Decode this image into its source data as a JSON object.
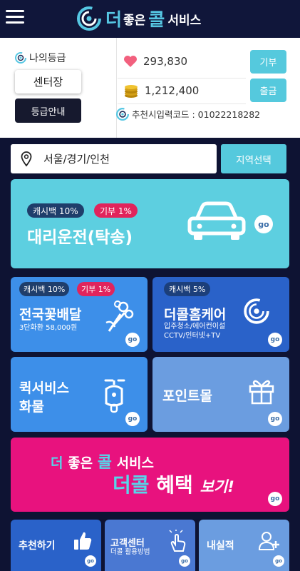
{
  "header": {
    "logo_part1": "더",
    "logo_part2": "좋은",
    "logo_part3": "콜",
    "logo_part4": "서비스"
  },
  "profile": {
    "grade_label": "나의등급",
    "grade_value": "센터장",
    "grade_button": "등급안내",
    "points": "293,830",
    "donate_button": "기부",
    "coins": "1,212,400",
    "withdraw_button": "출금",
    "referral_label": "추천시입력코드 : 01022218282"
  },
  "location": {
    "value": "서울/경기/인천",
    "select_button": "지역선택"
  },
  "cards": {
    "driver": {
      "cashback": "캐시백 10%",
      "donate": "기부 1%",
      "title": "대리운전(탁송)",
      "go": "go"
    },
    "flower": {
      "cashback": "캐시백 10%",
      "donate": "기부 1%",
      "title": "전국꽃배달",
      "sub": "3단화환 58,000원",
      "go": "go"
    },
    "homecare": {
      "cashback": "캐시백 5%",
      "title": "더콜홈케어",
      "sub1": "입주청소/에어컨이설",
      "sub2": "CCTV/인터넷+TV",
      "go": "go"
    },
    "quick": {
      "title1": "퀵서비스",
      "title2": "화물",
      "go": "go"
    },
    "pointmall": {
      "title": "포인트몰",
      "go": "go"
    }
  },
  "banner": {
    "line1_a": "더",
    "line1_b": "좋은",
    "line1_c": "콜",
    "line1_d": "서비스",
    "line2_a": "더콜",
    "line2_b": "혜택",
    "line2_c": "보기!",
    "go": "go"
  },
  "bottom": {
    "recommend": "추천하기",
    "support_title": "고객센터",
    "support_sub": "더콜 활용방법",
    "results": "내실적",
    "go": "go"
  },
  "colors": {
    "navy": "#0e1333",
    "teal": "#55c9dd",
    "pink": "#e1245c",
    "blue": "#2a63c9",
    "light_blue": "#3b8ee8",
    "magenta": "#e8127e"
  }
}
